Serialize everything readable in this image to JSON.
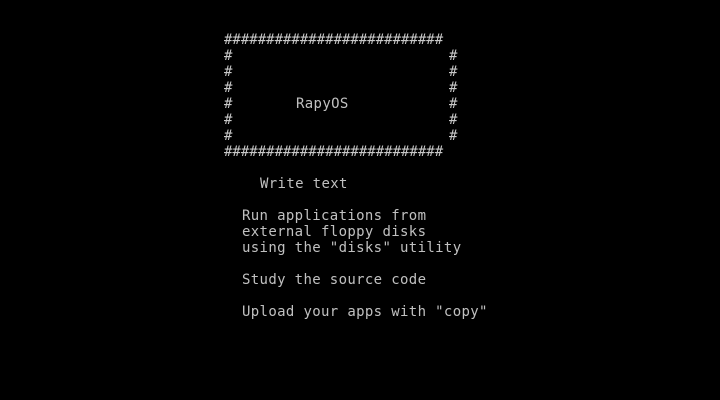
{
  "screen": {
    "foreground": "#c0c0c0",
    "background": "#000000",
    "banner": {
      "top": "##########################",
      "side_left": "#",
      "side_right": "#",
      "title": "RapyOS",
      "bottom": "##########################"
    },
    "menu": [
      {
        "text": "Write text"
      },
      {
        "text": "Run applications from"
      },
      {
        "text": "external floppy disks"
      },
      {
        "text": "using the \"disks\" utility"
      },
      {
        "text": "Study the source code"
      },
      {
        "text": "Upload your apps with \"copy\""
      }
    ]
  }
}
